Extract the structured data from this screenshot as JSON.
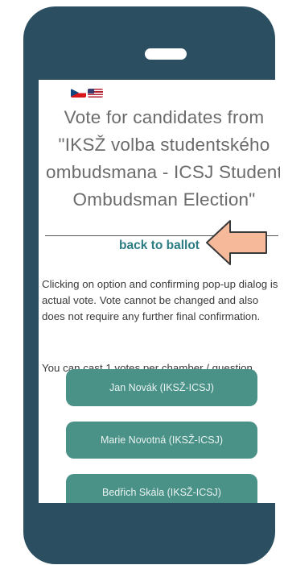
{
  "language_flags": {
    "czech": "czech-flag-icon",
    "english": "us-flag-icon"
  },
  "page": {
    "title": "Vote for candidates from \"IKSŽ volba studentského ombudsmana - ICSJ Student Ombudsman Election\"",
    "back_link": "back to ballot",
    "instructions": "Clicking on option and confirming pop-up dialog is actual vote. Vote cannot be changed and also does not require any further final confirmation.",
    "votes_note": "You can cast 1 votes per chamber / question."
  },
  "options": [
    {
      "label": "Jan Novák (IKSŽ-ICSJ)"
    },
    {
      "label": "Marie Novotná (IKSŽ-ICSJ)"
    },
    {
      "label": "Bedřich Skála (IKSŽ-ICSJ)"
    }
  ],
  "colors": {
    "phone_frame": "#2b4f61",
    "button_bg": "#4a9187",
    "link": "#2c7c84",
    "arrow_fill": "#f6b999",
    "arrow_stroke": "#3a3a3a"
  }
}
